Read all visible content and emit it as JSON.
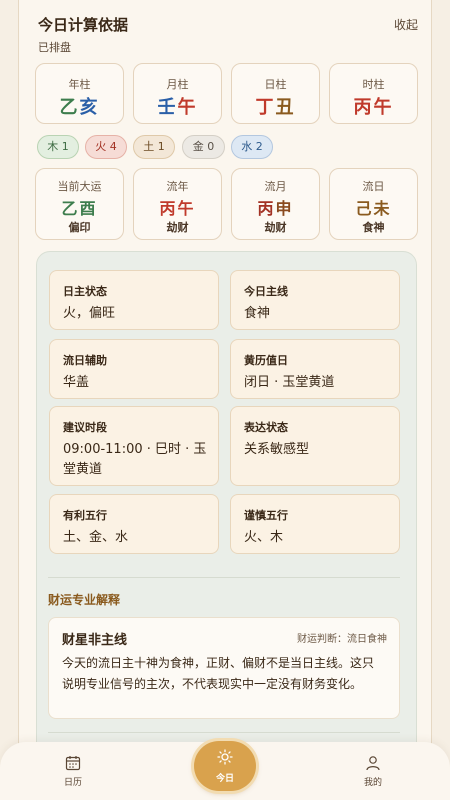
{
  "header": {
    "title": "今日计算依据",
    "collapse_label": "收起",
    "subtitle": "已排盘"
  },
  "pillars": [
    {
      "label": "年柱",
      "stem": "乙",
      "branch": "亥",
      "stem_color": "#3d7d4d",
      "branch_color": "#2a5fa8"
    },
    {
      "label": "月柱",
      "stem": "壬",
      "branch": "午",
      "stem_color": "#2a5fa8",
      "branch_color": "#c03a2b"
    },
    {
      "label": "日柱",
      "stem": "丁",
      "branch": "丑",
      "stem_color": "#c03a2b",
      "branch_color": "#8a5a1e"
    },
    {
      "label": "时柱",
      "stem": "丙",
      "branch": "午",
      "stem_color": "#c03a2b",
      "branch_color": "#c03a2b"
    }
  ],
  "elements": [
    {
      "label": "木 1",
      "bg": "#e3efe0",
      "border": "#b9d3b3",
      "color": "#3d6b42"
    },
    {
      "label": "火 4",
      "bg": "#f6dcd6",
      "border": "#e6b2a7",
      "color": "#a33224"
    },
    {
      "label": "土 1",
      "bg": "#f3e7d7",
      "border": "#dfc9a9",
      "color": "#6b4a22"
    },
    {
      "label": "金 0",
      "bg": "#ece9e4",
      "border": "#d4cfc6",
      "color": "#5a5249"
    },
    {
      "label": "水 2",
      "bg": "#dde8f4",
      "border": "#b3c7df",
      "color": "#2d5a8c"
    }
  ],
  "luck": [
    {
      "label": "当前大运",
      "stem": "乙",
      "branch": "酉",
      "stem_color": "#3d7d4d",
      "branch_color": "#3d7d4d",
      "god": "偏印"
    },
    {
      "label": "流年",
      "stem": "丙",
      "branch": "午",
      "stem_color": "#c03a2b",
      "branch_color": "#c03a2b",
      "god": "劫财"
    },
    {
      "label": "流月",
      "stem": "丙",
      "branch": "申",
      "stem_color": "#a33224",
      "branch_color": "#8a4a1e",
      "god": "劫财"
    },
    {
      "label": "流日",
      "stem": "己",
      "branch": "未",
      "stem_color": "#8a5a1e",
      "branch_color": "#8a5a1e",
      "god": "食神"
    }
  ],
  "info": [
    {
      "title": "日主状态",
      "value": "火，偏旺"
    },
    {
      "title": "今日主线",
      "value": "食神"
    },
    {
      "title": "流日辅助",
      "value": "华盖"
    },
    {
      "title": "黄历值日",
      "value": "闭日 · 玉堂黄道"
    },
    {
      "title": "建议时段",
      "value": "09:00-11:00 · 巳时 · 玉堂黄道"
    },
    {
      "title": "表达状态",
      "value": "关系敏感型"
    },
    {
      "title": "有利五行",
      "value": "土、金、水"
    },
    {
      "title": "谨慎五行",
      "value": "火、木"
    }
  ],
  "wealth": {
    "section_title": "财运专业解释",
    "card_title": "财星非主线",
    "judgment": "财运判断：流日食神",
    "body": "今天的流日主十神为食神，正财、偏财不是当日主线。这只说明专业信号的主次，不代表现实中一定没有财务变化。"
  },
  "nav": {
    "calendar": "日历",
    "today": "今日",
    "mine": "我的"
  }
}
